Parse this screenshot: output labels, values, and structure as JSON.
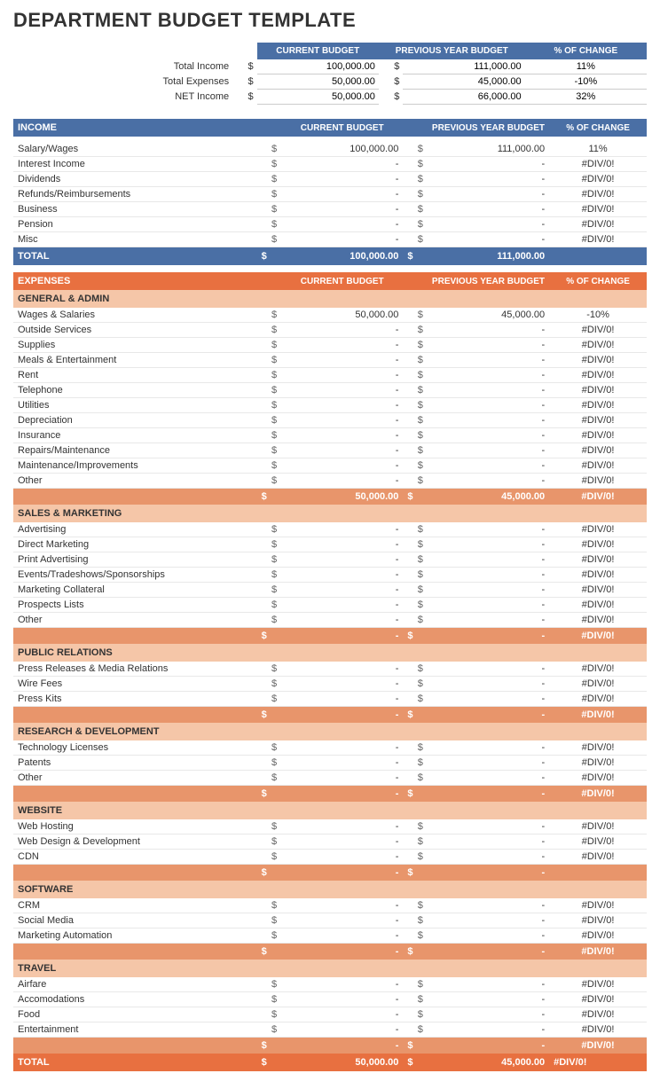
{
  "title": "DEPARTMENT BUDGET TEMPLATE",
  "summary": {
    "headers": [
      "",
      "",
      "CURRENT BUDGET",
      "",
      "PREVIOUS YEAR BUDGET",
      "% OF CHANGE"
    ],
    "rows": [
      {
        "label": "Total Income",
        "curr_dollar": "$",
        "curr_val": "100,000.00",
        "prev_dollar": "$",
        "prev_val": "111,000.00",
        "pct": "11%"
      },
      {
        "label": "Total Expenses",
        "curr_dollar": "$",
        "curr_val": "50,000.00",
        "prev_dollar": "$",
        "prev_val": "45,000.00",
        "pct": "-10%"
      },
      {
        "label": "NET Income",
        "curr_dollar": "$",
        "curr_val": "50,000.00",
        "prev_dollar": "$",
        "prev_val": "66,000.00",
        "pct": "32%"
      }
    ]
  },
  "income": {
    "section_label": "INCOME",
    "col_current": "CURRENT BUDGET",
    "col_previous": "PREVIOUS YEAR BUDGET",
    "col_pct": "% OF CHANGE",
    "rows": [
      {
        "label": "Salary/Wages",
        "curr": "100,000.00",
        "prev": "111,000.00",
        "pct": "11%"
      },
      {
        "label": "Interest Income",
        "curr": "-",
        "prev": "-",
        "pct": "#DIV/0!"
      },
      {
        "label": "Dividends",
        "curr": "-",
        "prev": "-",
        "pct": "#DIV/0!"
      },
      {
        "label": "Refunds/Reimbursements",
        "curr": "-",
        "prev": "-",
        "pct": "#DIV/0!"
      },
      {
        "label": "Business",
        "curr": "-",
        "prev": "-",
        "pct": "#DIV/0!"
      },
      {
        "label": "Pension",
        "curr": "-",
        "prev": "-",
        "pct": "#DIV/0!"
      },
      {
        "label": "Misc",
        "curr": "-",
        "prev": "-",
        "pct": "#DIV/0!"
      }
    ],
    "total_label": "TOTAL",
    "total_curr": "100,000.00",
    "total_prev": "111,000.00"
  },
  "expenses": {
    "section_label": "EXPENSES",
    "col_current": "CURRENT BUDGET",
    "col_previous": "PREVIOUS YEAR BUDGET",
    "col_pct": "% OF CHANGE",
    "subsections": [
      {
        "label": "GENERAL & ADMIN",
        "rows": [
          {
            "label": "Wages & Salaries",
            "curr": "50,000.00",
            "prev": "45,000.00",
            "pct": "-10%"
          },
          {
            "label": "Outside Services",
            "curr": "-",
            "prev": "-",
            "pct": "#DIV/0!"
          },
          {
            "label": "Supplies",
            "curr": "-",
            "prev": "-",
            "pct": "#DIV/0!"
          },
          {
            "label": "Meals & Entertainment",
            "curr": "-",
            "prev": "-",
            "pct": "#DIV/0!"
          },
          {
            "label": "Rent",
            "curr": "-",
            "prev": "-",
            "pct": "#DIV/0!"
          },
          {
            "label": "Telephone",
            "curr": "-",
            "prev": "-",
            "pct": "#DIV/0!"
          },
          {
            "label": "Utilities",
            "curr": "-",
            "prev": "-",
            "pct": "#DIV/0!"
          },
          {
            "label": "Depreciation",
            "curr": "-",
            "prev": "-",
            "pct": "#DIV/0!"
          },
          {
            "label": "Insurance",
            "curr": "-",
            "prev": "-",
            "pct": "#DIV/0!"
          },
          {
            "label": "Repairs/Maintenance",
            "curr": "-",
            "prev": "-",
            "pct": "#DIV/0!"
          },
          {
            "label": "Maintenance/Improvements",
            "curr": "-",
            "prev": "-",
            "pct": "#DIV/0!"
          },
          {
            "label": "Other",
            "curr": "-",
            "prev": "-",
            "pct": "#DIV/0!"
          }
        ],
        "subtotal_curr": "50,000.00",
        "subtotal_prev": "45,000.00",
        "subtotal_pct": "#DIV/0!"
      },
      {
        "label": "SALES & MARKETING",
        "rows": [
          {
            "label": "Advertising",
            "curr": "-",
            "prev": "-",
            "pct": "#DIV/0!"
          },
          {
            "label": "Direct Marketing",
            "curr": "-",
            "prev": "-",
            "pct": "#DIV/0!"
          },
          {
            "label": "Print Advertising",
            "curr": "-",
            "prev": "-",
            "pct": "#DIV/0!"
          },
          {
            "label": "Events/Tradeshows/Sponsorships",
            "curr": "-",
            "prev": "-",
            "pct": "#DIV/0!"
          },
          {
            "label": "Marketing Collateral",
            "curr": "-",
            "prev": "-",
            "pct": "#DIV/0!"
          },
          {
            "label": "Prospects Lists",
            "curr": "-",
            "prev": "-",
            "pct": "#DIV/0!"
          },
          {
            "label": "Other",
            "curr": "-",
            "prev": "-",
            "pct": "#DIV/0!"
          }
        ],
        "subtotal_curr": "-",
        "subtotal_prev": "-",
        "subtotal_pct": "#DIV/0!"
      },
      {
        "label": "PUBLIC RELATIONS",
        "rows": [
          {
            "label": "Press Releases & Media Relations",
            "curr": "-",
            "prev": "-",
            "pct": "#DIV/0!"
          },
          {
            "label": "Wire Fees",
            "curr": "-",
            "prev": "-",
            "pct": "#DIV/0!"
          },
          {
            "label": "Press Kits",
            "curr": "-",
            "prev": "-",
            "pct": "#DIV/0!"
          }
        ],
        "subtotal_curr": "-",
        "subtotal_prev": "-",
        "subtotal_pct": "#DIV/0!"
      },
      {
        "label": "RESEARCH & DEVELOPMENT",
        "rows": [
          {
            "label": "Technology Licenses",
            "curr": "-",
            "prev": "-",
            "pct": "#DIV/0!"
          },
          {
            "label": "Patents",
            "curr": "-",
            "prev": "-",
            "pct": "#DIV/0!"
          },
          {
            "label": "Other",
            "curr": "-",
            "prev": "-",
            "pct": "#DIV/0!"
          }
        ],
        "subtotal_curr": "-",
        "subtotal_prev": "-",
        "subtotal_pct": "#DIV/0!"
      },
      {
        "label": "WEBSITE",
        "rows": [
          {
            "label": "Web Hosting",
            "curr": "-",
            "prev": "-",
            "pct": "#DIV/0!"
          },
          {
            "label": "Web Design & Development",
            "curr": "-",
            "prev": "-",
            "pct": "#DIV/0!"
          },
          {
            "label": "CDN",
            "curr": "-",
            "prev": "-",
            "pct": "#DIV/0!"
          }
        ],
        "subtotal_curr": "-",
        "subtotal_prev": "-",
        "subtotal_pct": ""
      },
      {
        "label": "SOFTWARE",
        "rows": [
          {
            "label": "CRM",
            "curr": "-",
            "prev": "-",
            "pct": "#DIV/0!"
          },
          {
            "label": "Social Media",
            "curr": "-",
            "prev": "-",
            "pct": "#DIV/0!"
          },
          {
            "label": "Marketing Automation",
            "curr": "-",
            "prev": "-",
            "pct": "#DIV/0!"
          }
        ],
        "subtotal_curr": "-",
        "subtotal_prev": "-",
        "subtotal_pct": "#DIV/0!"
      },
      {
        "label": "TRAVEL",
        "rows": [
          {
            "label": "Airfare",
            "curr": "-",
            "prev": "-",
            "pct": "#DIV/0!"
          },
          {
            "label": "Accomodations",
            "curr": "-",
            "prev": "-",
            "pct": "#DIV/0!"
          },
          {
            "label": "Food",
            "curr": "-",
            "prev": "-",
            "pct": "#DIV/0!"
          },
          {
            "label": "Entertainment",
            "curr": "-",
            "prev": "-",
            "pct": "#DIV/0!"
          }
        ],
        "subtotal_curr": "-",
        "subtotal_prev": "-",
        "subtotal_pct": "#DIV/0!"
      }
    ],
    "total_label": "TOTAL",
    "total_curr": "50,000.00",
    "total_prev": "45,000.00",
    "total_pct": "#DIV/0!"
  }
}
